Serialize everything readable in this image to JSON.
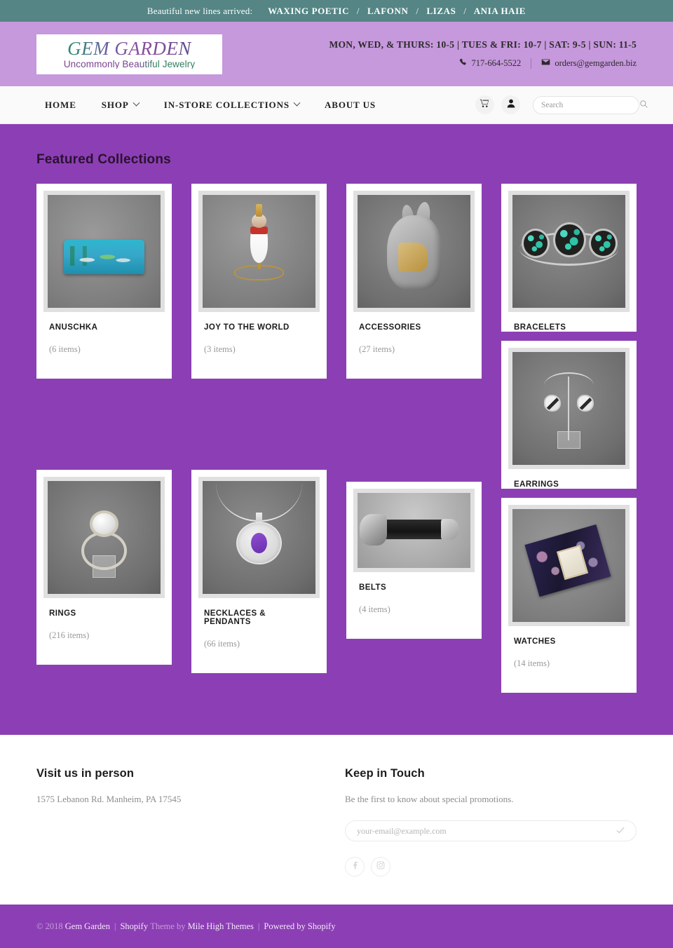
{
  "announcement": {
    "intro": "Beautiful new lines arrived:",
    "brands": [
      "WAXING POETIC",
      "LAFONN",
      "LIZAS",
      "ANIA HAIE"
    ],
    "separator": "/",
    "bg_color": "#558585"
  },
  "header": {
    "logo_main": "GEM GARDEN",
    "logo_sub": "Uncommonly Beautiful Jewelry",
    "hours": "MON, WED, & THURS: 10-5  |  TUES & FRI: 10-7  |  SAT: 9-5  |  SUN: 11-5",
    "phone": "717-664-5522",
    "email": "orders@gemgarden.biz",
    "bg_color": "#c698dc"
  },
  "nav": {
    "items": [
      {
        "label": "HOME",
        "has_dropdown": false
      },
      {
        "label": "SHOP",
        "has_dropdown": true
      },
      {
        "label": "IN-STORE COLLECTIONS",
        "has_dropdown": true
      },
      {
        "label": "ABOUT US",
        "has_dropdown": false
      }
    ],
    "cart_icon": "shopping-cart-icon",
    "account_icon": "user-account-icon",
    "search_placeholder": "Search",
    "search_value": ""
  },
  "main": {
    "title": "Featured Collections",
    "bg_color": "#8c3fb4",
    "columns": [
      {
        "cards": [
          {
            "title": "ANUSCHKA",
            "count": "(6 items)",
            "art": "wallet"
          },
          {
            "title": "RINGS",
            "count": "(216 items)",
            "art": "ring"
          }
        ]
      },
      {
        "cards": [
          {
            "title": "JOY TO THE WORLD",
            "count": "(3 items)",
            "art": "ornament"
          },
          {
            "title": "NECKLACES & PENDANTS",
            "count": "(66 items)",
            "art": "pendant"
          }
        ]
      },
      {
        "cards": [
          {
            "title": "ACCESSORIES",
            "count": "(27 items)",
            "art": "bunny"
          },
          {
            "title": "BELTS",
            "count": "(4 items)",
            "art": "belt"
          }
        ]
      },
      {
        "cards": [
          {
            "title": "BRACELETS",
            "count": "",
            "art": "bracelet"
          },
          {
            "title": "EARRINGS",
            "count": "",
            "art": "earrings"
          },
          {
            "title": "WATCHES",
            "count": "(14 items)",
            "art": "watch"
          }
        ]
      }
    ]
  },
  "footer": {
    "visit_heading": "Visit us in person",
    "address": "1575 Lebanon Rd. Manheim, PA 17545",
    "keep_heading": "Keep in Touch",
    "keep_text": "Be the first to know about special promotions.",
    "newsletter_placeholder": "your-email@example.com",
    "newsletter_value": "",
    "submit_icon": "checkmark-icon",
    "socials": [
      {
        "name": "facebook-icon",
        "glyph": "f"
      },
      {
        "name": "instagram-icon",
        "glyph": ""
      }
    ]
  },
  "copyright": {
    "symbol_year": "© 2018",
    "store": "Gem Garden",
    "theme_prefix": "Shopify",
    "theme_mid": "Theme by",
    "theme_name": "Mile High Themes",
    "powered": "Powered by Shopify",
    "pipe": "|"
  }
}
